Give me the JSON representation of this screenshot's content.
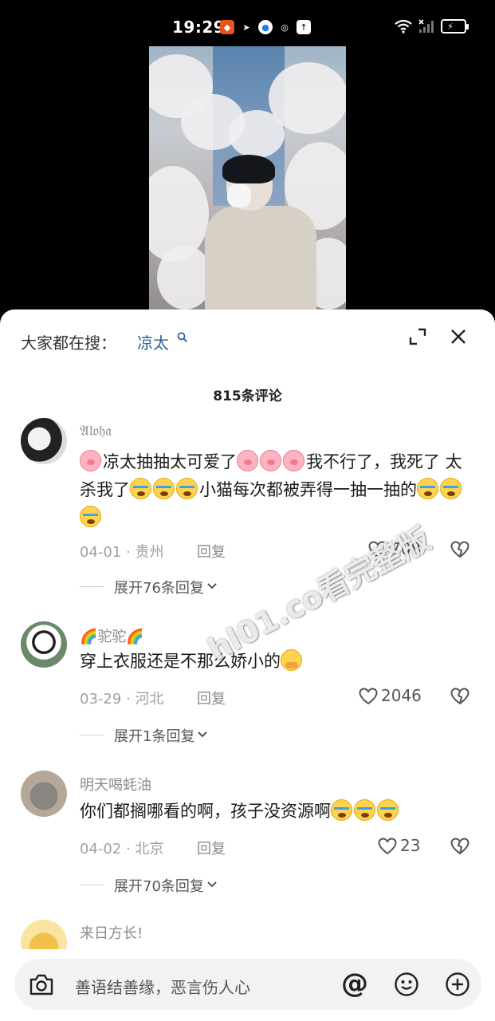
{
  "status_bar": {
    "time": "19:29"
  },
  "search": {
    "hint": "大家都在搜：",
    "term": "凉太"
  },
  "comments_header": {
    "count_label": "815条评论"
  },
  "comments": [
    {
      "name": "𝔄𝔩𝔬𝔥𝔞",
      "segments": [
        {
          "e": "pig"
        },
        {
          "t": "凉太抽抽太可爱了"
        },
        {
          "e": "pig"
        },
        {
          "e": "pig"
        },
        {
          "e": "pig"
        },
        {
          "t": "我不行了，我死了 太杀我了"
        },
        {
          "e": "cry"
        },
        {
          "e": "cry"
        },
        {
          "e": "cry"
        },
        {
          "t": "小猫每次都被弄得一抽一抽的"
        },
        {
          "e": "cry"
        },
        {
          "e": "cry"
        },
        {
          "e": "cry"
        }
      ],
      "meta": "04-01 · 贵州",
      "reply_label": "回复",
      "likes": "708",
      "expand_label": "展开76条回复"
    },
    {
      "name": "🌈驼驼🌈",
      "segments": [
        {
          "t": "穿上衣服还是不那么娇小的"
        },
        {
          "e": "shy"
        }
      ],
      "meta": "03-29 · 河北",
      "reply_label": "回复",
      "likes": "2046",
      "expand_label": "展开1条回复"
    },
    {
      "name": "明天喝蚝油",
      "segments": [
        {
          "t": "你们都搁哪看的啊，孩子没资源啊"
        },
        {
          "e": "cry"
        },
        {
          "e": "cry"
        },
        {
          "e": "cry"
        }
      ],
      "meta": "04-02 · 北京",
      "reply_label": "回复",
      "likes": "23",
      "expand_label": "展开70条回复"
    },
    {
      "name": "来日方长!"
    }
  ],
  "watermark": "hl01.co看完整版",
  "input": {
    "placeholder": "善语结善缘，恶言伤人心"
  },
  "colors": {
    "link": "#2f5f99",
    "sheet": "#ffffff",
    "input_bg": "#f2f2f2"
  },
  "icons": [
    "camera-icon",
    "at-icon",
    "emoji-icon",
    "plus-icon",
    "expand-icon",
    "close-icon",
    "heart-icon",
    "broken-heart-icon",
    "search-icon"
  ]
}
